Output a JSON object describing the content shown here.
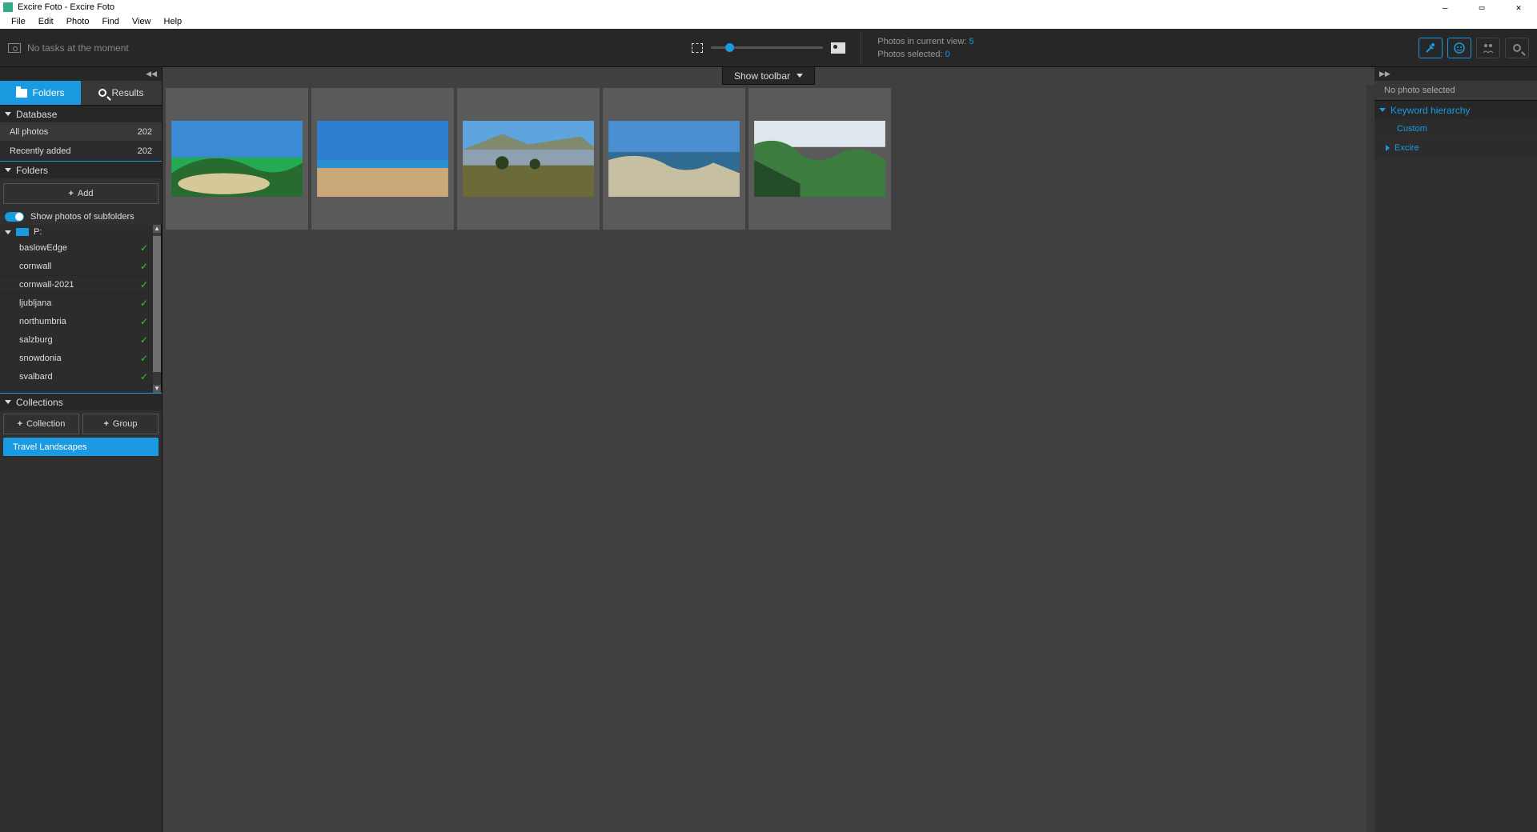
{
  "title": "Excire Foto - Excire Foto",
  "menubar": [
    "File",
    "Edit",
    "Photo",
    "Find",
    "View",
    "Help"
  ],
  "tasks_text": "No tasks at the moment",
  "status": {
    "view_label": "Photos in current view:",
    "view_count": "5",
    "selected_label": "Photos selected:",
    "selected_count": "0"
  },
  "left": {
    "tab_folders": "Folders",
    "tab_results": "Results",
    "database_header": "Database",
    "db_rows": [
      {
        "label": "All photos",
        "count": "202"
      },
      {
        "label": "Recently added",
        "count": "202"
      }
    ],
    "folders_header": "Folders",
    "add_btn": "Add",
    "subfolder_toggle": "Show photos of subfolders",
    "drive": "P:",
    "folder_items": [
      "baslowEdge",
      "cornwall",
      "cornwall-2021",
      "ljubljana",
      "northumbria",
      "salzburg",
      "snowdonia",
      "svalbard"
    ],
    "collections_header": "Collections",
    "collection_btn1": "Collection",
    "collection_btn2": "Group",
    "collection_item": "Travel Landscapes"
  },
  "center": {
    "show_toolbar": "Show toolbar"
  },
  "right": {
    "no_photo": "No photo selected",
    "keyword_header": "Keyword hierarchy",
    "keyword_rows": [
      {
        "label": "Custom",
        "expandable": false
      },
      {
        "label": "Excire",
        "expandable": true
      }
    ]
  }
}
